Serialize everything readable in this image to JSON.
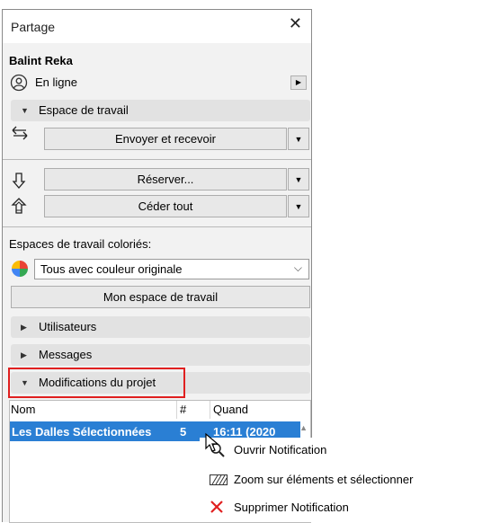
{
  "window": {
    "title": "Partage"
  },
  "user": {
    "name": "Balint Reka",
    "status": "En ligne"
  },
  "workspace": {
    "header": "Espace de travail",
    "send_receive": "Envoyer et recevoir",
    "reserve": "Réserver...",
    "release_all": "Céder tout"
  },
  "colored": {
    "label": "Espaces de travail coloriés:",
    "selected_option": "Tous avec couleur originale",
    "my_workspace_button": "Mon espace de travail"
  },
  "sections": {
    "users": "Utilisateurs",
    "messages": "Messages",
    "project_changes": "Modifications du projet"
  },
  "table": {
    "columns": [
      "Nom",
      "#",
      "Quand"
    ],
    "rows": [
      {
        "name": "Les Dalles Sélectionnées",
        "count": "5",
        "when": "16:11 (2020"
      }
    ]
  },
  "context_menu": {
    "items": [
      {
        "label": "Ouvrir Notification",
        "icon": "magnifier-icon"
      },
      {
        "label": "Zoom sur éléments et sélectionner",
        "icon": "hatched-zoom-icon"
      },
      {
        "label": "Supprimer Notification",
        "icon": "red-x-icon"
      }
    ]
  },
  "colors": {
    "highlight": "#2a7fd4",
    "annotation_box": "#e02020",
    "delete_red": "#e02020"
  }
}
